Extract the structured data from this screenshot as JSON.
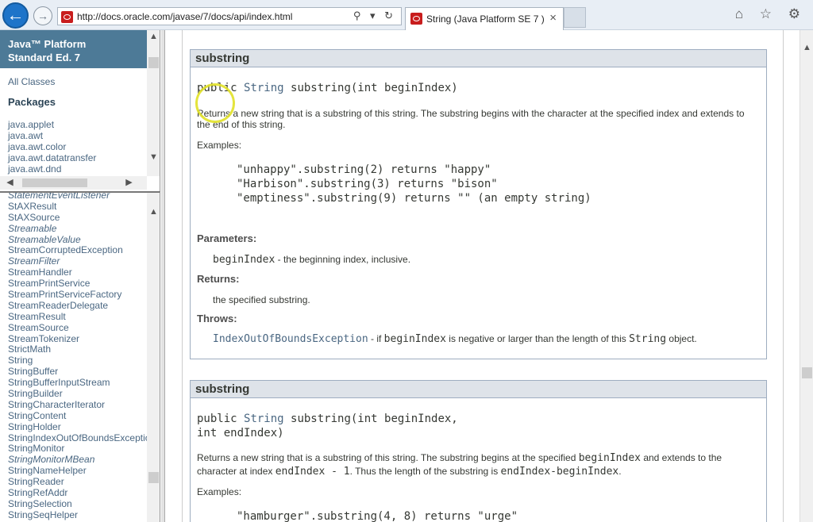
{
  "browser": {
    "url": "http://docs.oracle.com/javase/7/docs/api/index.html",
    "tab_title": "String (Java Platform SE 7 )",
    "tab_close": "×",
    "back": "←",
    "forward": "→",
    "addr_icons": "⚲ ▾ ↻",
    "tool_icons": "⌂ ☆ ⚙"
  },
  "sidebar": {
    "header_line1": "Java™ Platform",
    "header_line2": "Standard Ed. 7",
    "all_classes": "All Classes",
    "packages_heading": "Packages",
    "packages": [
      "java.applet",
      "java.awt",
      "java.awt.color",
      "java.awt.datatransfer",
      "java.awt.dnd"
    ],
    "classes": [
      {
        "name": "StatementEventListener",
        "italic": true
      },
      {
        "name": "StAXResult",
        "italic": false
      },
      {
        "name": "StAXSource",
        "italic": false
      },
      {
        "name": "Streamable",
        "italic": true
      },
      {
        "name": "StreamableValue",
        "italic": true
      },
      {
        "name": "StreamCorruptedException",
        "italic": false
      },
      {
        "name": "StreamFilter",
        "italic": true
      },
      {
        "name": "StreamHandler",
        "italic": false
      },
      {
        "name": "StreamPrintService",
        "italic": false
      },
      {
        "name": "StreamPrintServiceFactory",
        "italic": false
      },
      {
        "name": "StreamReaderDelegate",
        "italic": false
      },
      {
        "name": "StreamResult",
        "italic": false
      },
      {
        "name": "StreamSource",
        "italic": false
      },
      {
        "name": "StreamTokenizer",
        "italic": false
      },
      {
        "name": "StrictMath",
        "italic": false
      },
      {
        "name": "String",
        "italic": false
      },
      {
        "name": "StringBuffer",
        "italic": false
      },
      {
        "name": "StringBufferInputStream",
        "italic": false
      },
      {
        "name": "StringBuilder",
        "italic": false
      },
      {
        "name": "StringCharacterIterator",
        "italic": false
      },
      {
        "name": "StringContent",
        "italic": false
      },
      {
        "name": "StringHolder",
        "italic": false
      },
      {
        "name": "StringIndexOutOfBoundsException",
        "italic": false
      },
      {
        "name": "StringMonitor",
        "italic": false
      },
      {
        "name": "StringMonitorMBean",
        "italic": true
      },
      {
        "name": "StringNameHelper",
        "italic": false
      },
      {
        "name": "StringReader",
        "italic": false
      },
      {
        "name": "StringRefAddr",
        "italic": false
      },
      {
        "name": "StringSelection",
        "italic": false
      },
      {
        "name": "StringSeqHelper",
        "italic": false
      }
    ]
  },
  "method1": {
    "heading": "substring",
    "sig_pre": "public ",
    "sig_type": "String",
    "sig_post": " substring(int beginIndex)",
    "desc_line1": "Returns a new string that is a substring of this string. The substring begins with the character at the specified index and extends to",
    "desc_line2": "the end of this string.",
    "examples_label": "Examples:",
    "examples": [
      "\"unhappy\".substring(2) returns \"happy\"",
      "\"Harbison\".substring(3) returns \"bison\"",
      "\"emptiness\".substring(9) returns \"\" (an empty string)"
    ],
    "parameters_label": "Parameters:",
    "param_name": "beginIndex",
    "param_desc": " - the beginning index, inclusive.",
    "returns_label": "Returns:",
    "returns_desc": "the specified substring.",
    "throws_label": "Throws:",
    "throws_link": "IndexOutOfBoundsException",
    "throws_t1": " - if ",
    "throws_code1": "beginIndex",
    "throws_t2": " is negative or larger than the length of this ",
    "throws_code2": "String",
    "throws_t3": " object."
  },
  "method2": {
    "heading": "substring",
    "sig_pre": "public ",
    "sig_type": "String",
    "sig_post": " substring(int beginIndex,",
    "sig_line2": "                 int endIndex)",
    "desc_t1": "Returns a new string that is a substring of this string. The substring begins at the specified ",
    "desc_code1": "beginIndex",
    "desc_t2": " and extends to the",
    "desc_t3": "character at index ",
    "desc_code2": "endIndex - 1",
    "desc_t4": ". Thus the length of the substring is ",
    "desc_code3": "endIndex-beginIndex",
    "desc_t5": ".",
    "examples_label": "Examples:",
    "example1": "\"hamburger\".substring(4, 8) returns \"urge\""
  }
}
